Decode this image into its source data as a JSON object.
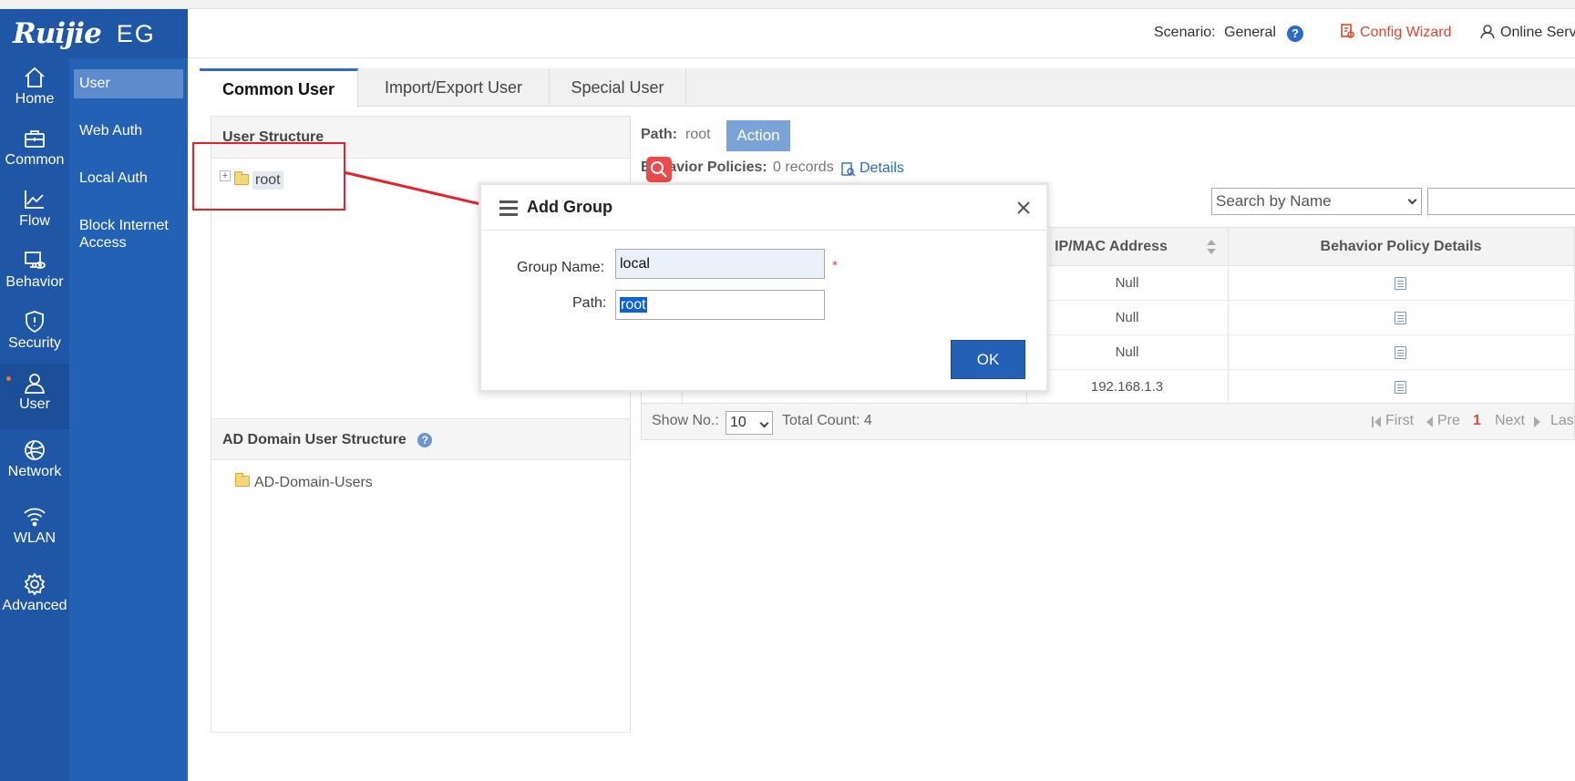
{
  "brand": {
    "logo": "Ruijie",
    "product": "EG"
  },
  "header": {
    "scenario_label": "Scenario:",
    "scenario_value": "General",
    "config_wizard": "Config Wizard",
    "online_service": "Online Serv"
  },
  "nav": {
    "items": [
      {
        "label": "Home",
        "icon": "home-icon"
      },
      {
        "label": "Common",
        "icon": "briefcase-icon"
      },
      {
        "label": "Flow",
        "icon": "chart-line-icon"
      },
      {
        "label": "Behavior",
        "icon": "monitor-eye-icon"
      },
      {
        "label": "Security",
        "icon": "shield-alert-icon"
      },
      {
        "label": "User",
        "icon": "user-icon"
      },
      {
        "label": "Network",
        "icon": "globe-icon"
      },
      {
        "label": "WLAN",
        "icon": "wifi-icon"
      },
      {
        "label": "Advanced",
        "icon": "gear-icon"
      }
    ],
    "active": "User"
  },
  "subnav": {
    "items": [
      "User",
      "Web Auth",
      "Local Auth",
      "Block Internet Access"
    ],
    "active": "User"
  },
  "tabs": [
    "Common User",
    "Import/Export User",
    "Special User"
  ],
  "left_panel": {
    "user_structure_title": "User Structure",
    "root_label": "root",
    "ad_title": "AD Domain User Structure",
    "ad_node": "AD-Domain-Users"
  },
  "right_panel": {
    "path_label": "Path:",
    "path_value": "root",
    "action_button": "Action",
    "behavior_label": "Behavior Policies:",
    "behavior_value": "0 records",
    "details_link": "Details",
    "search_select": "Search by Name",
    "table": {
      "headers": [
        "IP/MAC Address",
        "Behavior Policy Details"
      ],
      "rows": [
        {
          "ip": "Null"
        },
        {
          "ip": "Null"
        },
        {
          "ip": "Null"
        },
        {
          "ip": "192.168.1.3"
        }
      ]
    },
    "pager": {
      "show_no_label": "Show No.:",
      "page_size": "10",
      "total_count": "Total Count: 4",
      "first": "First",
      "pre": "Pre",
      "current": "1",
      "next": "Next",
      "last": "Last"
    }
  },
  "dialog": {
    "title": "Add Group",
    "group_name_label": "Group Name:",
    "group_name_value": "local",
    "required_mark": "*",
    "path_label": "Path:",
    "path_value": "root",
    "ok_button": "OK"
  },
  "colors": {
    "nav_bg": "#1f57a6",
    "subnav_bg": "#2361b5",
    "accent_blue": "#2360b6",
    "annotation_red": "#e8202a",
    "wizard_red": "#e6432f"
  }
}
